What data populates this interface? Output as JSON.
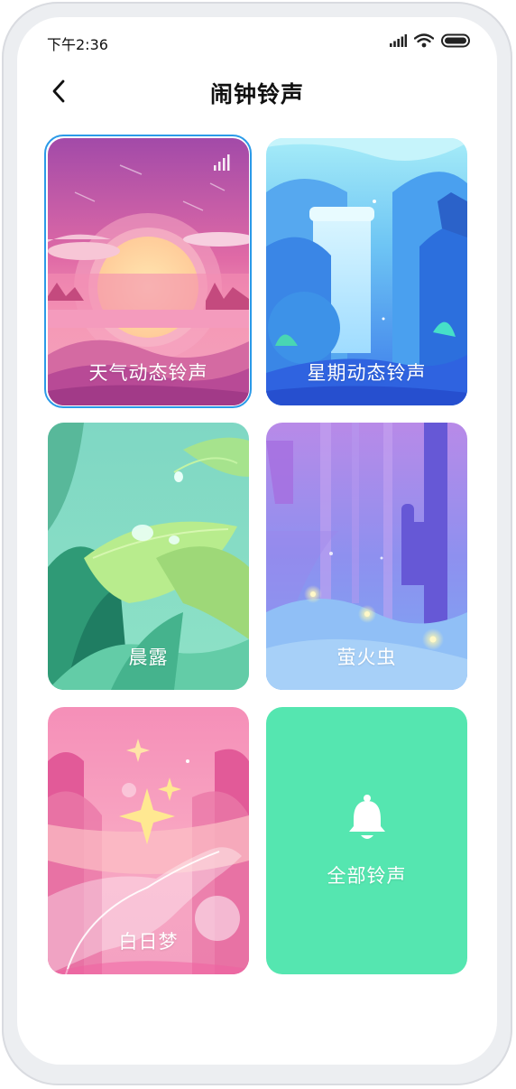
{
  "status_bar": {
    "time": "下午2:36",
    "icons": [
      "signal-icon",
      "wifi-icon",
      "battery-icon"
    ]
  },
  "header": {
    "back_icon": "chevron-left-icon",
    "title": "闹钟铃声"
  },
  "cards": [
    {
      "label": "天气动态铃声",
      "selected": true,
      "badge_icon": "bar-chart-icon"
    },
    {
      "label": "星期动态铃声",
      "selected": false
    },
    {
      "label": "晨露",
      "selected": false
    },
    {
      "label": "萤火虫",
      "selected": false
    },
    {
      "label": "白日梦",
      "selected": false
    },
    {
      "label": "全部铃声",
      "selected": false,
      "icon": "bell-icon"
    }
  ],
  "colors": {
    "selected_border": "#2b9ae8",
    "all_ringtones_bg": "#55e6b0"
  }
}
